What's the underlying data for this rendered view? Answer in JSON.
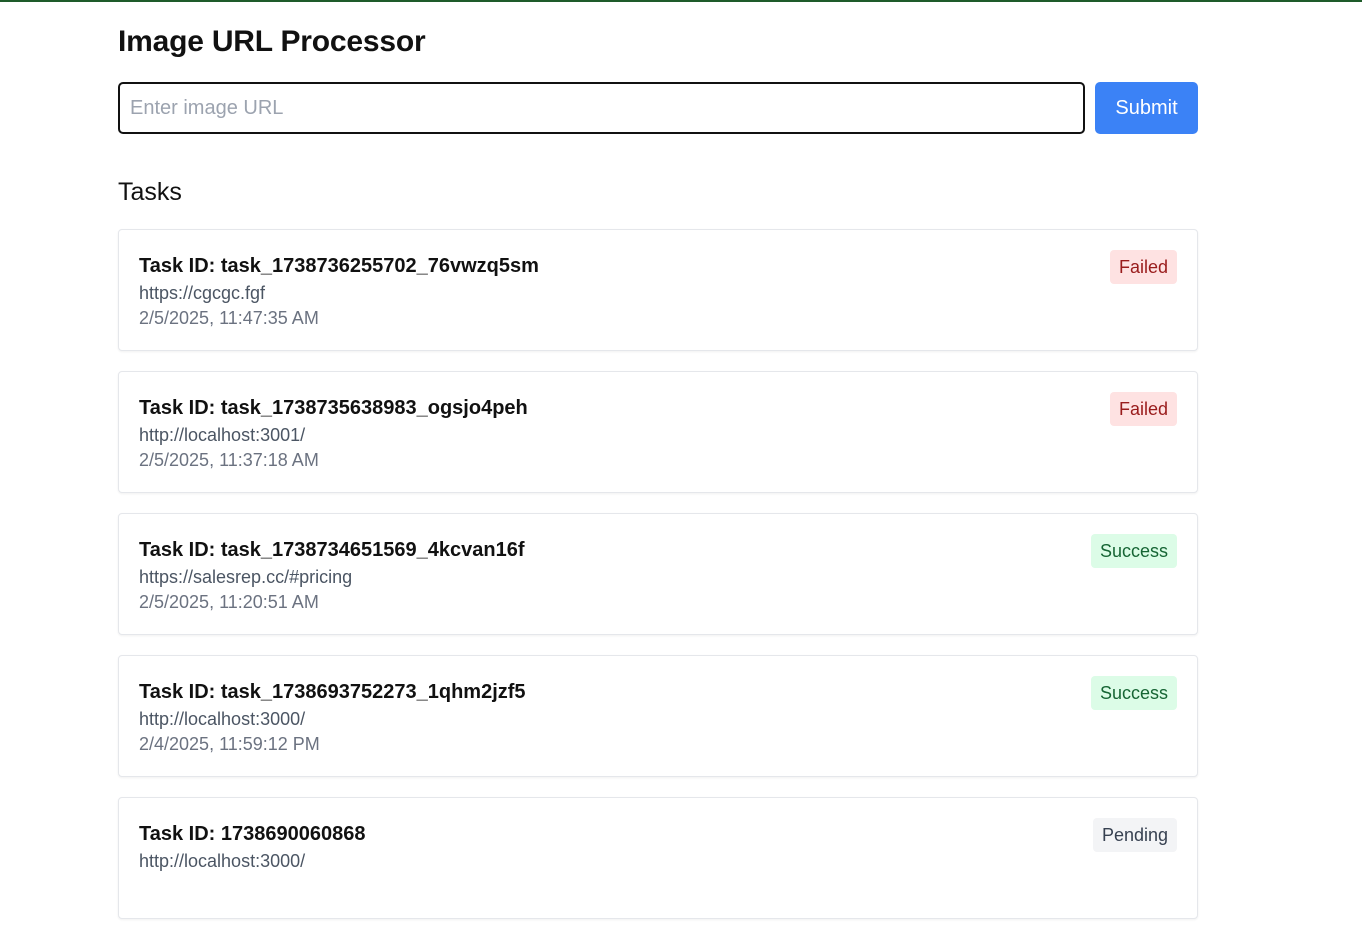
{
  "header": {
    "title": "Image URL Processor"
  },
  "form": {
    "placeholder": "Enter image URL",
    "value": "",
    "submit_label": "Submit"
  },
  "tasks_heading": "Tasks",
  "tasks": [
    {
      "id_label": "Task ID: task_1738736255702_76vwzq5sm",
      "url": "https://cgcgc.fgf",
      "timestamp": "2/5/2025, 11:47:35 AM",
      "status": "Failed",
      "status_kind": "failed"
    },
    {
      "id_label": "Task ID: task_1738735638983_ogsjo4peh",
      "url": "http://localhost:3001/",
      "timestamp": "2/5/2025, 11:37:18 AM",
      "status": "Failed",
      "status_kind": "failed"
    },
    {
      "id_label": "Task ID: task_1738734651569_4kcvan16f",
      "url": "https://salesrep.cc/#pricing",
      "timestamp": "2/5/2025, 11:20:51 AM",
      "status": "Success",
      "status_kind": "success"
    },
    {
      "id_label": "Task ID: task_1738693752273_1qhm2jzf5",
      "url": "http://localhost:3000/",
      "timestamp": "2/4/2025, 11:59:12 PM",
      "status": "Success",
      "status_kind": "success"
    },
    {
      "id_label": "Task ID: 1738690060868",
      "url": "http://localhost:3000/",
      "timestamp": "",
      "status": "Pending",
      "status_kind": "pending"
    }
  ],
  "colors": {
    "accent_bar": "#1e5b2a",
    "submit_bg": "#3b82f6",
    "failed_bg": "#fee2e2",
    "failed_text": "#991b1b",
    "success_bg": "#dcfce7",
    "success_text": "#166534",
    "pending_bg": "#f3f4f6",
    "pending_text": "#374151"
  }
}
